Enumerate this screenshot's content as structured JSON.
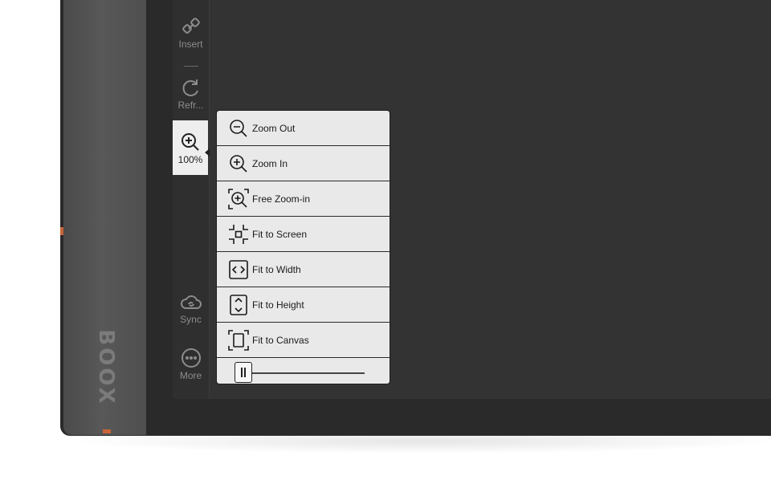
{
  "brand": "BOOX",
  "toolbar": {
    "insert_label": "Insert",
    "refresh_label": "Refr...",
    "zoom_value": "100%",
    "sync_label": "Sync",
    "more_label": "More"
  },
  "zoom_menu": {
    "items": [
      {
        "label": "Zoom Out",
        "icon": "zoom-out-icon"
      },
      {
        "label": "Zoom In",
        "icon": "zoom-in-icon"
      },
      {
        "label": "Free Zoom-in",
        "icon": "free-zoom-icon"
      },
      {
        "label": "Fit to Screen",
        "icon": "fit-screen-icon"
      },
      {
        "label": "Fit to Width",
        "icon": "fit-width-icon"
      },
      {
        "label": "Fit to Height",
        "icon": "fit-height-icon"
      },
      {
        "label": "Fit to Canvas",
        "icon": "fit-canvas-icon"
      }
    ],
    "slider_value": 0
  },
  "colors": {
    "accent": "#c8643a",
    "menu_bg": "#e9e9e9",
    "screen_bg": "#333333"
  }
}
